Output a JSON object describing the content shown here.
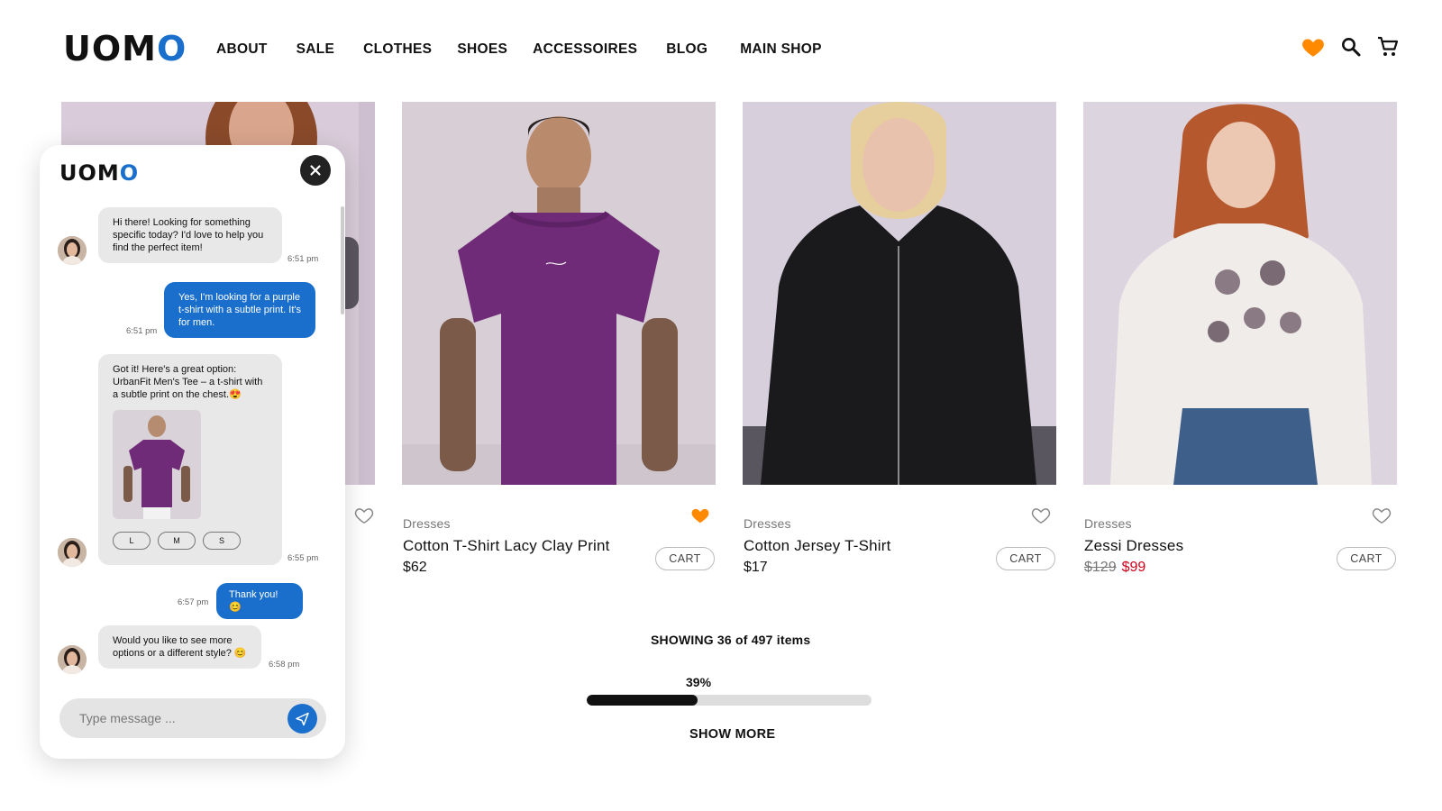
{
  "brand": {
    "logo_start": "UOM",
    "logo_end": "O",
    "accent": "#1a6fcc"
  },
  "nav": [
    "ABOUT",
    "SALE",
    "CLOTHES",
    "SHOES",
    "ACCESSOIRES",
    "BLOG",
    "MAIN SHOP"
  ],
  "header_icons": [
    "heart-icon",
    "search-icon",
    "cart-icon"
  ],
  "products": [
    {
      "category": "Dresses",
      "name": "Cotton T-Shirt Lacy Clay Print",
      "price": "$62",
      "cart_label": "CART",
      "favorited": true
    },
    {
      "category": "Dresses",
      "name": "Cotton Jersey T-Shirt",
      "price": "$17",
      "cart_label": "CART",
      "favorited": false
    },
    {
      "category": "Dresses",
      "name": "Zessi Dresses",
      "old_price": "$129",
      "sale_price": "$99",
      "cart_label": "CART",
      "favorited": false
    }
  ],
  "paging": {
    "showing": "SHOWING 36 of 497 items",
    "percent_label": "39%",
    "progress": 0.39,
    "show_more": "SHOW MORE"
  },
  "chat": {
    "logo_start": "UOM",
    "logo_end": "O",
    "messages": [
      {
        "from": "bot",
        "text": "Hi there! Looking for something specific today? I'd love to help you find the perfect item!",
        "time": "6:51 pm"
      },
      {
        "from": "user",
        "text": "Yes, I'm looking for a purple  t-shirt with a subtle print. It's for men.",
        "time": "6:51 pm"
      },
      {
        "from": "bot",
        "text": "Got it! Here's a great option: UrbanFit Men's Tee – a t-shirt with a subtle print on the chest.😍",
        "time": "6:55 pm",
        "sizes": [
          "L",
          "M",
          "S"
        ]
      },
      {
        "from": "user",
        "text": "Thank you! 😊",
        "time": "6:57 pm"
      },
      {
        "from": "bot",
        "text": "Would you like to see more options or a different style? 😊",
        "time": "6:58 pm"
      }
    ],
    "input_placeholder": "Type message ..."
  },
  "colors": {
    "favorite": "#ff8a00",
    "sale": "#d0021b",
    "chat_user": "#1a6fcc"
  }
}
